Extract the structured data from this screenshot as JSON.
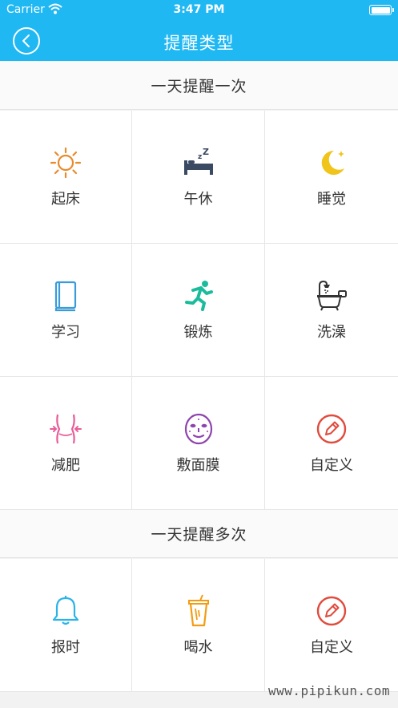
{
  "status_bar": {
    "carrier": "Carrier",
    "time": "3:47 PM"
  },
  "nav": {
    "title": "提醒类型"
  },
  "sections": [
    {
      "title": "一天提醒一次",
      "items": [
        {
          "label": "起床",
          "icon": "sun-icon",
          "color": "#e98a2b"
        },
        {
          "label": "午休",
          "icon": "bed-sleep-icon",
          "color": "#3b4a63"
        },
        {
          "label": "睡觉",
          "icon": "moon-icon",
          "color": "#f0c419"
        },
        {
          "label": "学习",
          "icon": "book-icon",
          "color": "#3a9bd8"
        },
        {
          "label": "锻炼",
          "icon": "running-icon",
          "color": "#1abc9c"
        },
        {
          "label": "洗澡",
          "icon": "bathtub-icon",
          "color": "#333333"
        },
        {
          "label": "减肥",
          "icon": "waist-icon",
          "color": "#e85d9a"
        },
        {
          "label": "敷面膜",
          "icon": "face-mask-icon",
          "color": "#8e44ad"
        },
        {
          "label": "自定义",
          "icon": "pencil-circle-icon",
          "color": "#e04b3c"
        }
      ]
    },
    {
      "title": "一天提醒多次",
      "items": [
        {
          "label": "报时",
          "icon": "bell-icon",
          "color": "#2bb3e8"
        },
        {
          "label": "喝水",
          "icon": "cup-icon",
          "color": "#f39c12"
        },
        {
          "label": "自定义",
          "icon": "pencil-circle-icon",
          "color": "#e04b3c"
        }
      ]
    }
  ],
  "watermark": "www.pipikun.com"
}
